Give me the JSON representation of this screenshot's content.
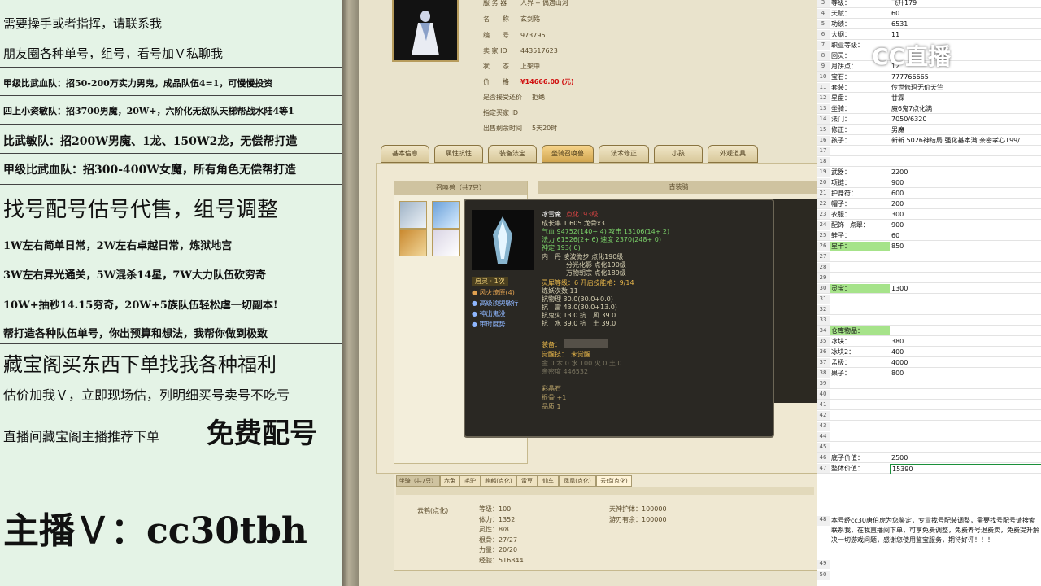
{
  "left_panel": {
    "lines": [
      "需要操手或者指挥，请联系我",
      "朋友圈各种单号，组号，看号加Ｖ私聊我",
      "甲级比武血队：招50-200万实力男鬼，成品队伍4=1，可慢慢投资",
      "四上小资敏队：招3700男魔，20W+，六阶化无敌队天梯帮战水陆4等1",
      "比武敏队：招200W男魔、1龙、150W2龙，无偿帮打造",
      "甲级比武血队：招300-400W女魔，所有角色无偿帮打造",
      "找号配号估号代售，组号调整",
      "1W左右简单日常，2W左右卓越日常，炼狱地宫",
      "3W左右异光通关，5W混杀14星，7W大力队伍砍穷奇",
      "10W+抽秒14.15穷奇，20W+5族队伍轻松虐一切副本!",
      "帮打造各种队伍单号，你出预算和想法，我帮你做到极致",
      "藏宝阁买东西下单找我各种福利",
      "估价加我Ｖ，立即现场估，列明细买号卖号不吃亏",
      "直播间藏宝阁主播推荐下单",
      "免费配号",
      "主播Ｖ：cc30tbh"
    ]
  },
  "game": {
    "info": [
      {
        "k": "服 务 器",
        "v": "人界 -- 偶遇山河"
      },
      {
        "k": "名　　称",
        "v": "玄剑殇"
      },
      {
        "k": "编　　号",
        "v": "973795"
      },
      {
        "k": "卖 家 ID",
        "v": "443517623"
      },
      {
        "k": "状　　态",
        "v": "上架中"
      },
      {
        "k": "价　　格",
        "v": "¥14666.00 (元)"
      },
      {
        "k": "是否接受还价",
        "v": "拒绝"
      },
      {
        "k": "指定买家 ID",
        "v": ""
      },
      {
        "k": "出售剩余时间",
        "v": "5天20时"
      }
    ],
    "tabs": [
      "基本信息",
      "属性抗性",
      "装备法宝",
      "坐骑召唤兽",
      "法术修正",
      "小孩",
      "外观道具"
    ],
    "pet_header": "召唤兽（共7只）",
    "right_header": "古装骑",
    "tooltip": {
      "name": "冰雪魔",
      "level": "点化193级",
      "growth": "成长率 1.605 龙骨x3",
      "hp": "气血 94752(140+ 4) 攻击 13106(14+ 2)",
      "mp": "法力 61526(2+ 6) 速度 2370(248+ 0)",
      "mind": "神定 193( 0)",
      "inner1": "内　丹 凌波微步 点化190级",
      "inner2": "分光化影 点化190级",
      "inner3": "万物朝宗 点化189级",
      "awaken": "启灵 · 1次",
      "skills": [
        "风火燎原(4)",
        "高级须臾敏行",
        "神出鬼没",
        "审时度势"
      ],
      "spirit": "灵犀等级：6 开启技能格：9/14",
      "refine": "炼妖次数 11",
      "phys": "抗物理 30.0(30.0+0.0)",
      "thunder": "抗　雷 43.0(30.0+13.0)",
      "ghost": "抗鬼火 13.0 抗　风 39.0",
      "water": "抗　水 39.0 抗　土 39.0",
      "equip": "装备：",
      "awake_skill": "觉醒技：　未觉醒",
      "elements": "金 0 木 0 水 100 火 0 土 0",
      "bond": "亲密度 446532",
      "stone": "彩晶石",
      "bone": "根骨 +1",
      "quality": "品质 1"
    },
    "mount_tabs": [
      "坐骑（共7只）",
      "赤兔",
      "毛驴",
      "麒麟(点化)",
      "雷豆",
      "仙车",
      "凤凰(点化)",
      "云鹤(点化)"
    ],
    "mount_name": "云鹤(点化)",
    "mount_stats": [
      "等级：100",
      "体力：1352",
      "灵性：8/8",
      "根骨：27/27",
      "力量：20/20",
      "经验：516844"
    ],
    "mount_stats2": [
      "天神护体：100000",
      "游刃有余：100000"
    ]
  },
  "sheet": {
    "rows": [
      {
        "n": "3",
        "a": "等级：",
        "b": "飞升179"
      },
      {
        "n": "4",
        "a": "天赋：",
        "b": "60"
      },
      {
        "n": "5",
        "a": "功绩：",
        "b": "6531"
      },
      {
        "n": "6",
        "a": "大纲：",
        "b": "11"
      },
      {
        "n": "7",
        "a": "职业等级：",
        "b": ""
      },
      {
        "n": "8",
        "a": "回灵：",
        "b": ""
      },
      {
        "n": "9",
        "a": "月饼点：",
        "b": "12"
      },
      {
        "n": "10",
        "a": "宝石：",
        "b": "777766665"
      },
      {
        "n": "11",
        "a": "套装：",
        "b": "传世修玛无价天竺"
      },
      {
        "n": "12",
        "a": "星盘：",
        "b": "甘霖"
      },
      {
        "n": "13",
        "a": "坐骑：",
        "b": "魔6鬼7点化满"
      },
      {
        "n": "14",
        "a": "法门：",
        "b": "7050/6320"
      },
      {
        "n": "15",
        "a": "修正：",
        "b": "男魔"
      },
      {
        "n": "16",
        "a": "孩子：",
        "b": "新新 5026神结局 强化基本满 亲密孝心199/…"
      },
      {
        "n": "17",
        "a": "",
        "b": ""
      },
      {
        "n": "18",
        "a": "",
        "b": ""
      },
      {
        "n": "19",
        "a": "武器：",
        "b": "2200"
      },
      {
        "n": "20",
        "a": "项链：",
        "b": "900"
      },
      {
        "n": "21",
        "a": "护身符：",
        "b": "600"
      },
      {
        "n": "22",
        "a": "帽子：",
        "b": "200"
      },
      {
        "n": "23",
        "a": "衣服：",
        "b": "300"
      },
      {
        "n": "24",
        "a": "配饰+点翠：",
        "b": "900"
      },
      {
        "n": "25",
        "a": "鞋子：",
        "b": "60"
      },
      {
        "n": "26",
        "a": "星卡：",
        "b": "850",
        "g": true
      },
      {
        "n": "27",
        "a": "",
        "b": ""
      },
      {
        "n": "28",
        "a": "",
        "b": ""
      },
      {
        "n": "29",
        "a": "",
        "b": ""
      },
      {
        "n": "30",
        "a": "灵宝：",
        "b": "1300",
        "g": true
      },
      {
        "n": "31",
        "a": "",
        "b": ""
      },
      {
        "n": "32",
        "a": "",
        "b": ""
      },
      {
        "n": "33",
        "a": "",
        "b": ""
      },
      {
        "n": "34",
        "a": "仓库物品：",
        "b": "",
        "g": true
      },
      {
        "n": "35",
        "a": "冰块：",
        "b": "380"
      },
      {
        "n": "36",
        "a": "冰块2：",
        "b": "400"
      },
      {
        "n": "37",
        "a": "孟极：",
        "b": "4000"
      },
      {
        "n": "38",
        "a": "果子：",
        "b": "800"
      },
      {
        "n": "39",
        "a": "",
        "b": ""
      },
      {
        "n": "40",
        "a": "",
        "b": ""
      },
      {
        "n": "41",
        "a": "",
        "b": ""
      },
      {
        "n": "42",
        "a": "",
        "b": ""
      },
      {
        "n": "43",
        "a": "",
        "b": ""
      },
      {
        "n": "44",
        "a": "",
        "b": ""
      },
      {
        "n": "45",
        "a": "",
        "b": ""
      },
      {
        "n": "46",
        "a": "底子价值：",
        "b": "2500"
      },
      {
        "n": "47",
        "a": "整体价值：",
        "b": "15390"
      }
    ],
    "note_num": "48",
    "note": "本号经cc30唐伯虎为您鉴定，专业找号配装调整，需要找号配号请搜索联系我，在我直播间下单，可享免费调整，免费养号退费卖，免费提升解决一切游戏问题，感谢您使用鉴宝服务，期待好评！！！",
    "tail_rows": [
      "49",
      "50"
    ]
  },
  "logo": "CC直播"
}
